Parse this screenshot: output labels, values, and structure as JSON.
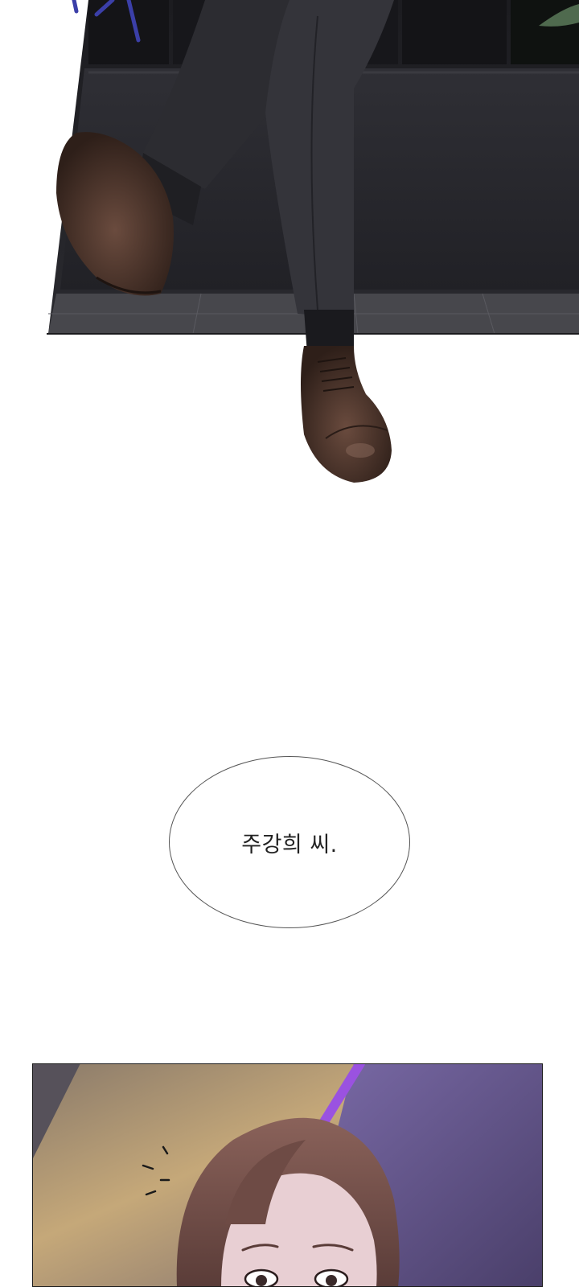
{
  "speech_bubble": {
    "text": "주강희 씨."
  },
  "colors": {
    "background": "#ffffff",
    "suit": "#2b2b2f",
    "shoe": "#3e2b23",
    "floor": "#4a4a4f",
    "hair": "#6b4a44",
    "purple_glow": "#7e62c8",
    "warm_light": "#d8b98a"
  }
}
